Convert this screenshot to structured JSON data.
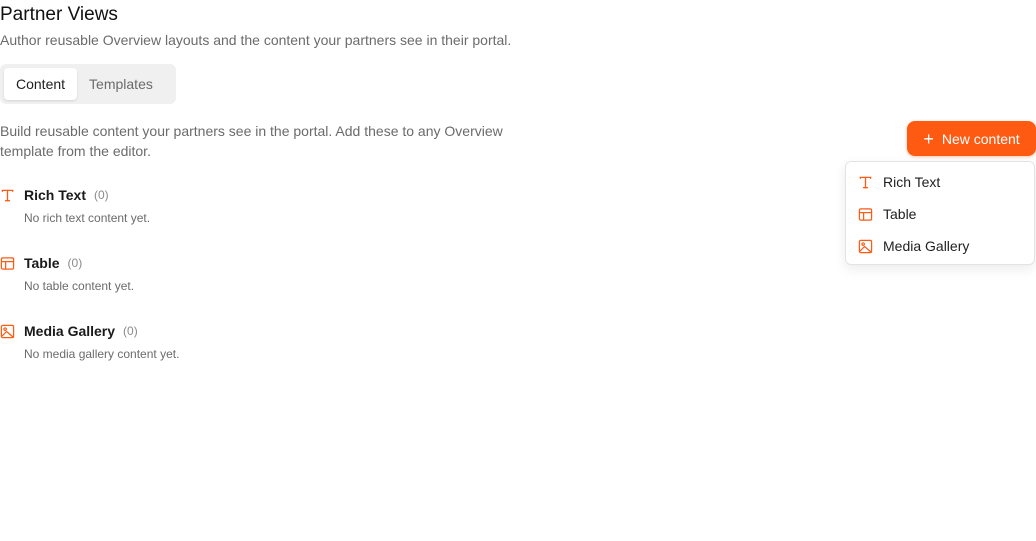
{
  "header": {
    "title": "Partner Views",
    "subtitle": "Author reusable Overview layouts and the content your partners see in their portal."
  },
  "tabs": [
    {
      "label": "Content",
      "active": true
    },
    {
      "label": "Templates",
      "active": false
    }
  ],
  "intro": "Build reusable content your partners see in the portal. Add these to any Overview template from the editor.",
  "new_content_button": {
    "label": "New content",
    "icon": "plus-icon"
  },
  "dropdown": {
    "items": [
      {
        "label": "Rich Text",
        "icon": "text-type-icon"
      },
      {
        "label": "Table",
        "icon": "table-icon"
      },
      {
        "label": "Media Gallery",
        "icon": "image-icon"
      }
    ]
  },
  "sections": [
    {
      "title": "Rich Text",
      "count": "(0)",
      "empty": "No rich text content yet.",
      "icon": "text-type-icon"
    },
    {
      "title": "Table",
      "count": "(0)",
      "empty": "No table content yet.",
      "icon": "table-icon"
    },
    {
      "title": "Media Gallery",
      "count": "(0)",
      "empty": "No media gallery content yet.",
      "icon": "image-icon"
    }
  ],
  "colors": {
    "accent": "#ff5a12"
  }
}
